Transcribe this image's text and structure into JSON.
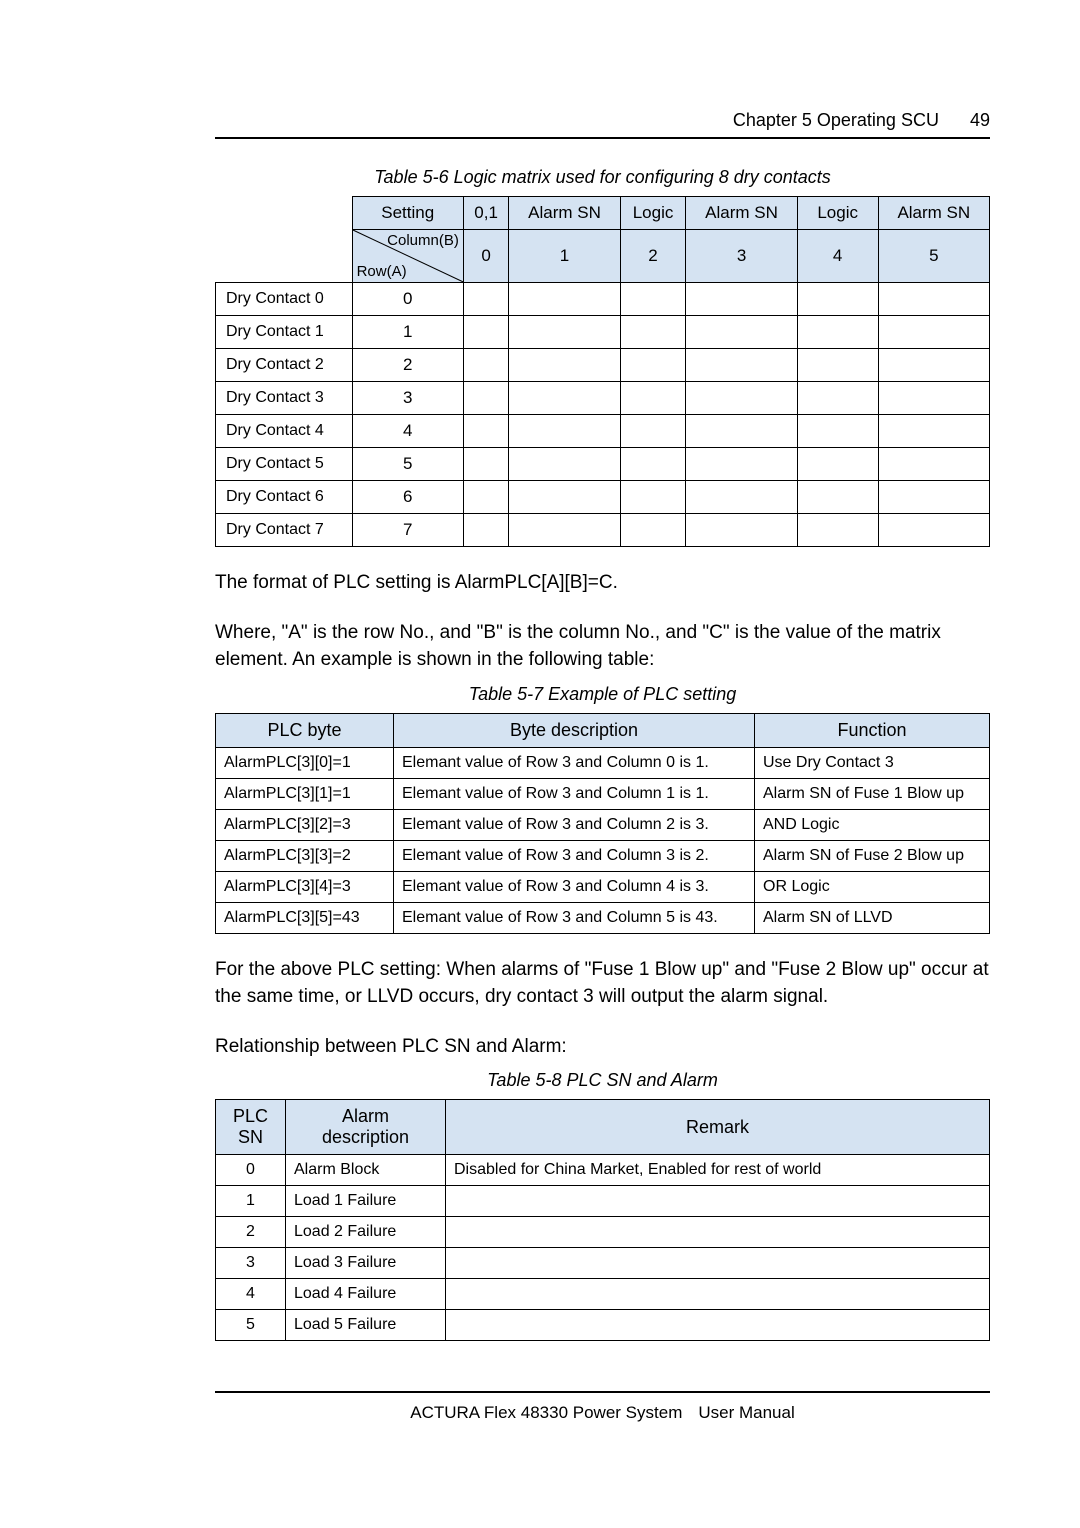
{
  "header": {
    "chapter": "Chapter 5   Operating SCU",
    "page": "49"
  },
  "table1": {
    "caption": "Table 5-6    Logic matrix used for configuring 8 dry contacts",
    "hdr_a": "Setting",
    "hdr_b": "0,1",
    "hdr_c": "Alarm SN",
    "hdr_d": "Logic",
    "hdr_e": "Alarm SN",
    "hdr_f": "Logic",
    "hdr_g": "Alarm SN",
    "diag_top": "Column(B)",
    "diag_bot": "Row(A)",
    "c0": "0",
    "c1": "1",
    "c2": "2",
    "c3": "3",
    "c4": "4",
    "c5": "5",
    "rows": [
      {
        "name": "Dry Contact 0",
        "v": "0"
      },
      {
        "name": "Dry Contact 1",
        "v": "1"
      },
      {
        "name": "Dry Contact 2",
        "v": "2"
      },
      {
        "name": "Dry Contact 3",
        "v": "3"
      },
      {
        "name": "Dry Contact 4",
        "v": "4"
      },
      {
        "name": "Dry Contact 5",
        "v": "5"
      },
      {
        "name": "Dry Contact 6",
        "v": "6"
      },
      {
        "name": "Dry Contact 7",
        "v": "7"
      }
    ]
  },
  "para1": "The format of PLC setting is AlarmPLC[A][B]=C.",
  "para2": "Where, \"A\" is the row No., and \"B\" is the column No., and \"C\" is the value of the matrix element. An example is shown in the following table:",
  "table2": {
    "caption": "Table 5-7    Example of PLC setting",
    "h1": "PLC byte",
    "h2": "Byte description",
    "h3": "Function",
    "rows": [
      {
        "a": "AlarmPLC[3][0]=1",
        "b": "Elemant value of Row 3 and Column 0 is 1.",
        "c": "Use Dry Contact 3"
      },
      {
        "a": "AlarmPLC[3][1]=1",
        "b": "Elemant value of Row 3 and Column 1 is 1.",
        "c": "Alarm SN of Fuse 1 Blow up"
      },
      {
        "a": "AlarmPLC[3][2]=3",
        "b": "Elemant value of Row 3 and Column 2 is 3.",
        "c": "AND Logic"
      },
      {
        "a": "AlarmPLC[3][3]=2",
        "b": "Elemant value of Row 3 and Column 3 is 2.",
        "c": "Alarm SN of Fuse 2 Blow up"
      },
      {
        "a": "AlarmPLC[3][4]=3",
        "b": "Elemant value of Row 3 and Column 4 is 3.",
        "c": "OR Logic"
      },
      {
        "a": "AlarmPLC[3][5]=43",
        "b": "Elemant value of Row 3 and Column 5 is 43.",
        "c": "Alarm SN of LLVD"
      }
    ]
  },
  "para3": "For the above PLC setting: When alarms of \"Fuse 1 Blow up\" and \"Fuse 2 Blow up\" occur at the same time, or LLVD occurs, dry contact 3 will output the alarm signal.",
  "para4": "Relationship between PLC SN and Alarm:",
  "table3": {
    "caption": "Table 5-8    PLC SN and Alarm",
    "h1a": "PLC",
    "h1b": "SN",
    "h2a": "Alarm",
    "h2b": "description",
    "h3": "Remark",
    "rows": [
      {
        "a": "0",
        "b": "Alarm Block",
        "c": "Disabled for China Market, Enabled for rest of world"
      },
      {
        "a": "1",
        "b": "Load 1 Failure",
        "c": ""
      },
      {
        "a": "2",
        "b": "Load 2 Failure",
        "c": ""
      },
      {
        "a": "3",
        "b": "Load 3 Failure",
        "c": ""
      },
      {
        "a": "4",
        "b": "Load 4 Failure",
        "c": ""
      },
      {
        "a": "5",
        "b": "Load 5 Failure",
        "c": ""
      }
    ]
  },
  "footer": {
    "a": "ACTURA Flex 48330 Power System",
    "b": "User Manual"
  }
}
